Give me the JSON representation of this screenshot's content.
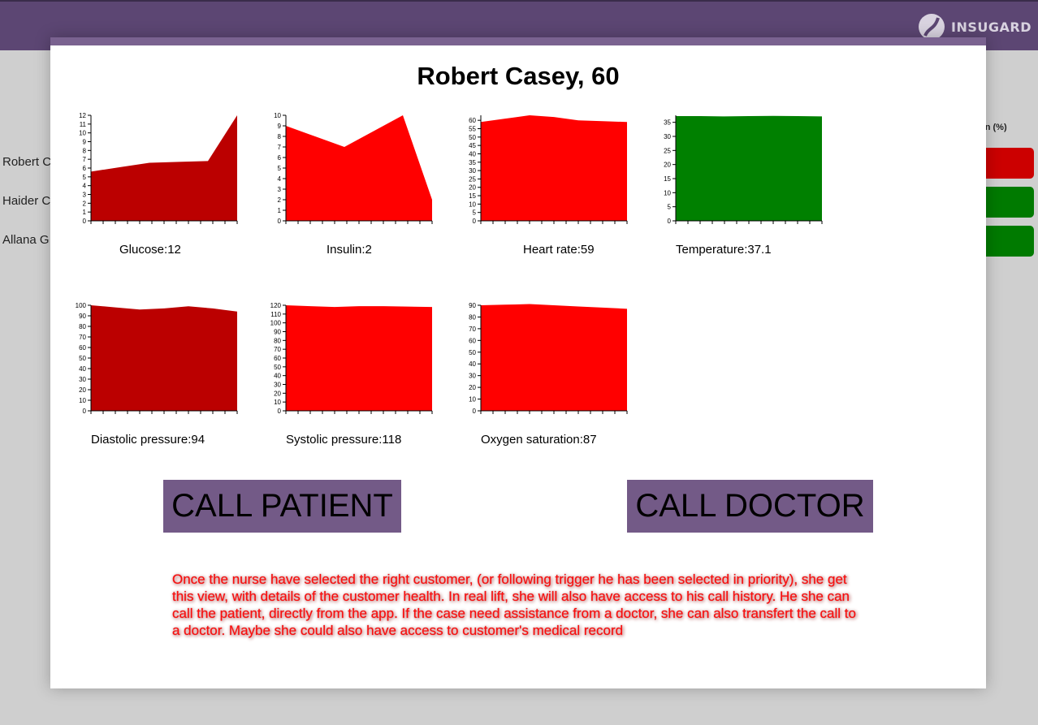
{
  "app": {
    "brand": "INSUGARD",
    "icon": "insugard-logo-icon"
  },
  "background": {
    "column_header": "on (%)",
    "rows": [
      {
        "name": "Robert C",
        "bar_color": "#cc0000"
      },
      {
        "name": "Haider C",
        "bar_color": "#007a00"
      },
      {
        "name": "Allana G",
        "bar_color": "#007a00"
      }
    ]
  },
  "modal": {
    "title": "Robert Casey, 60",
    "call_patient_label": "CALL PATIENT",
    "call_doctor_label": "CALL DOCTOR",
    "note": "Once the nurse have selected the right customer, (or following trigger he has been selected in priority), she get this view, with details of the customer health. In real lift, she will also have access to his call history. He she can call the patient, directly from the app. If the case need assistance from a doctor, she can also transfert the call to a doctor.  Maybe she could also have access to customer's medical record"
  },
  "chart_data": [
    {
      "type": "area",
      "caption": "Glucose:12",
      "color": "#bb0000",
      "x": [
        0,
        1,
        2,
        3,
        4,
        5,
        6,
        7,
        8,
        9
      ],
      "y": [
        5.6,
        6.1,
        6.6,
        6.7,
        6.8,
        12
      ],
      "ylim": [
        0,
        12
      ],
      "yticks": [
        0,
        1,
        2,
        3,
        4,
        5,
        6,
        7,
        8,
        9,
        10,
        11,
        12
      ]
    },
    {
      "type": "area",
      "caption": "Insulin:2",
      "color": "#ff0000",
      "y": [
        9,
        8,
        7,
        8.5,
        10,
        2
      ],
      "ylim": [
        0,
        10
      ],
      "yticks": [
        0,
        1,
        2,
        3,
        4,
        5,
        6,
        7,
        8,
        9,
        10
      ]
    },
    {
      "type": "area",
      "caption": "Heart rate:59",
      "color": "#ff0000",
      "y": [
        59,
        61,
        63,
        62,
        60,
        59.5,
        59
      ],
      "ylim": [
        0,
        63
      ],
      "yticks": [
        0,
        5,
        10,
        15,
        20,
        25,
        30,
        35,
        40,
        45,
        50,
        55,
        60
      ]
    },
    {
      "type": "area",
      "caption": "Temperature:37.1",
      "color": "#008000",
      "y": [
        37.2,
        37.2,
        37.1,
        37.2,
        37.3,
        37.2,
        37.1
      ],
      "ylim": [
        0,
        37.5
      ],
      "yticks": [
        0,
        5,
        10,
        15,
        20,
        25,
        30,
        35
      ]
    },
    {
      "type": "area",
      "caption": "Diastolic pressure:94",
      "color": "#bb0000",
      "y": [
        100,
        98,
        96,
        97,
        99,
        97,
        94
      ],
      "ylim": [
        0,
        100
      ],
      "yticks": [
        0,
        10,
        20,
        30,
        40,
        50,
        60,
        70,
        80,
        90,
        100
      ]
    },
    {
      "type": "area",
      "caption": "Systolic pressure:118",
      "color": "#ff0000",
      "y": [
        120,
        119,
        118,
        119,
        119,
        118.5,
        118
      ],
      "ylim": [
        0,
        120
      ],
      "yticks": [
        0,
        10,
        20,
        30,
        40,
        50,
        60,
        70,
        80,
        90,
        100,
        110,
        120
      ]
    },
    {
      "type": "area",
      "caption": "Oxygen saturation:87",
      "color": "#ff0000",
      "y": [
        90,
        90.5,
        91,
        90,
        89,
        88,
        87
      ],
      "ylim": [
        0,
        90
      ],
      "yticks": [
        0,
        10,
        20,
        30,
        40,
        50,
        60,
        70,
        80,
        90
      ]
    }
  ]
}
